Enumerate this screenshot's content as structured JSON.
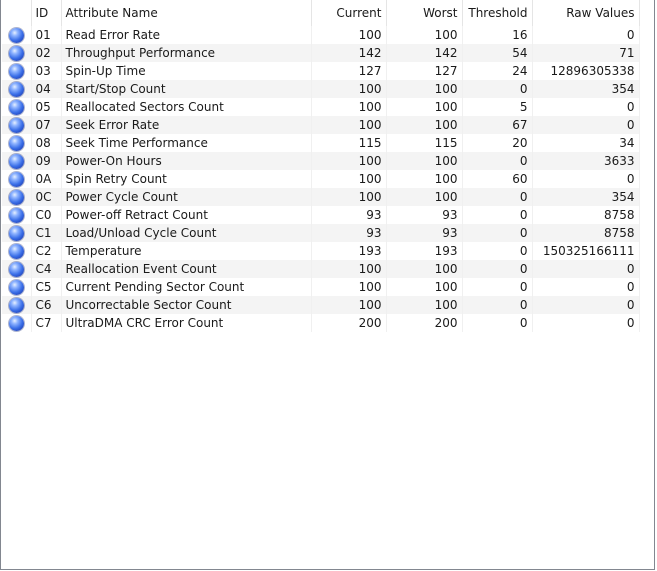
{
  "table": {
    "columns": {
      "id": "ID",
      "name": "Attribute Name",
      "current": "Current",
      "worst": "Worst",
      "threshold": "Threshold",
      "raw": "Raw Values"
    },
    "status_color": "#3b6fe8",
    "status_icon": "blue-status-dot-icon",
    "rows": [
      {
        "id": "01",
        "name": "Read Error Rate",
        "current": "100",
        "worst": "100",
        "threshold": "16",
        "raw": "0"
      },
      {
        "id": "02",
        "name": "Throughput Performance",
        "current": "142",
        "worst": "142",
        "threshold": "54",
        "raw": "71"
      },
      {
        "id": "03",
        "name": "Spin-Up Time",
        "current": "127",
        "worst": "127",
        "threshold": "24",
        "raw": "12896305338"
      },
      {
        "id": "04",
        "name": "Start/Stop Count",
        "current": "100",
        "worst": "100",
        "threshold": "0",
        "raw": "354"
      },
      {
        "id": "05",
        "name": "Reallocated Sectors Count",
        "current": "100",
        "worst": "100",
        "threshold": "5",
        "raw": "0"
      },
      {
        "id": "07",
        "name": "Seek Error Rate",
        "current": "100",
        "worst": "100",
        "threshold": "67",
        "raw": "0"
      },
      {
        "id": "08",
        "name": "Seek Time Performance",
        "current": "115",
        "worst": "115",
        "threshold": "20",
        "raw": "34"
      },
      {
        "id": "09",
        "name": "Power-On Hours",
        "current": "100",
        "worst": "100",
        "threshold": "0",
        "raw": "3633"
      },
      {
        "id": "0A",
        "name": "Spin Retry Count",
        "current": "100",
        "worst": "100",
        "threshold": "60",
        "raw": "0"
      },
      {
        "id": "0C",
        "name": "Power Cycle Count",
        "current": "100",
        "worst": "100",
        "threshold": "0",
        "raw": "354"
      },
      {
        "id": "C0",
        "name": "Power-off Retract Count",
        "current": "93",
        "worst": "93",
        "threshold": "0",
        "raw": "8758"
      },
      {
        "id": "C1",
        "name": "Load/Unload Cycle Count",
        "current": "93",
        "worst": "93",
        "threshold": "0",
        "raw": "8758"
      },
      {
        "id": "C2",
        "name": "Temperature",
        "current": "193",
        "worst": "193",
        "threshold": "0",
        "raw": "150325166111"
      },
      {
        "id": "C4",
        "name": "Reallocation Event Count",
        "current": "100",
        "worst": "100",
        "threshold": "0",
        "raw": "0"
      },
      {
        "id": "C5",
        "name": "Current Pending Sector Count",
        "current": "100",
        "worst": "100",
        "threshold": "0",
        "raw": "0"
      },
      {
        "id": "C6",
        "name": "Uncorrectable Sector Count",
        "current": "100",
        "worst": "100",
        "threshold": "0",
        "raw": "0"
      },
      {
        "id": "C7",
        "name": "UltraDMA CRC Error Count",
        "current": "200",
        "worst": "200",
        "threshold": "0",
        "raw": "0"
      }
    ]
  }
}
